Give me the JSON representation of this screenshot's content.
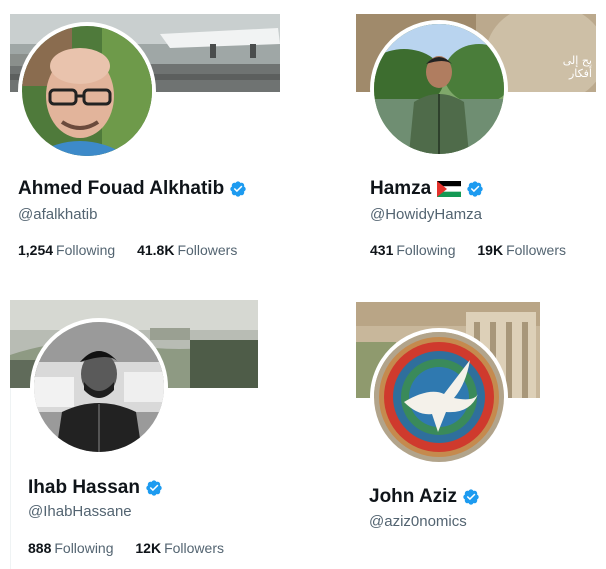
{
  "profiles": [
    {
      "name": "Ahmed Fouad Alkhatib",
      "handle": "@afalkhatib",
      "following_count": "1,254",
      "following_label": "Following",
      "followers_count": "41.8K",
      "followers_label": "Followers",
      "verified": true
    },
    {
      "name": "Hamza",
      "handle": "@HowidyHamza",
      "following_count": "431",
      "following_label": "Following",
      "followers_count": "19K",
      "followers_label": "Followers",
      "verified": true,
      "flag_icon": "palestine-flag-icon",
      "banner_text_line1": "يح إلى",
      "banner_text_line2": "أفكار"
    },
    {
      "name": "Ihab Hassan",
      "handle": "@IhabHassane",
      "following_count": "888",
      "following_label": "Following",
      "followers_count": "12K",
      "followers_label": "Followers",
      "verified": true
    },
    {
      "name": "John Aziz",
      "handle": "@aziz0nomics",
      "verified": true
    }
  ],
  "colors": {
    "verified_blue": "#1d9bf0",
    "secondary_text": "#536471",
    "primary_text": "#0f1419"
  }
}
